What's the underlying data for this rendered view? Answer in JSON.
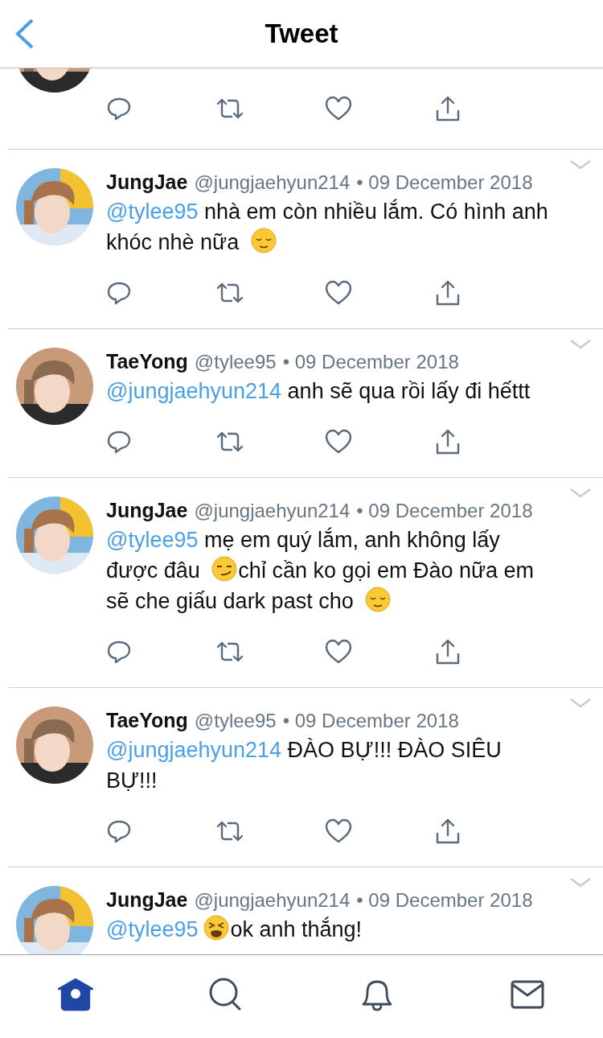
{
  "header": {
    "title": "Tweet"
  },
  "tweets": [
    {
      "partial": true,
      "avatar": {
        "kind": "picture"
      }
    },
    {
      "name": "JungJae",
      "handle": "@jungjaehyun214",
      "date": "• 09 December 2018",
      "avatar": {
        "kind": "picture"
      },
      "body": [
        {
          "kind": "mention",
          "text": "@tylee95"
        },
        {
          "kind": "text",
          "text": " nhà em còn nhiều lắm. Có hình anh khóc nhè nữa "
        },
        {
          "kind": "relieved"
        }
      ]
    },
    {
      "name": "TaeYong",
      "handle": "@tylee95",
      "date": "• 09 December 2018",
      "avatar": {
        "kind": "picture"
      },
      "body": [
        {
          "kind": "mention",
          "text": "@jungjaehyun214"
        },
        {
          "kind": "text",
          "text": " anh sẽ qua rồi lấy đi hếttt"
        }
      ]
    },
    {
      "name": "JungJae",
      "handle": "@jungjaehyun214",
      "date": "• 09 December 2018",
      "avatar": {
        "kind": "picture"
      },
      "body": [
        {
          "kind": "mention",
          "text": "@tylee95"
        },
        {
          "kind": "text",
          "text": " mẹ em quý lắm, anh không lấy được đâu "
        },
        {
          "kind": "smirk"
        },
        {
          "kind": "text",
          "text": "chỉ cần ko gọi em Đào nữa em sẽ che giấu dark past cho "
        },
        {
          "kind": "relieved"
        }
      ]
    },
    {
      "name": "TaeYong",
      "handle": "@tylee95",
      "date": "• 09 December 2018",
      "avatar": {
        "kind": "picture"
      },
      "body": [
        {
          "kind": "mention",
          "text": "@jungjaehyun214"
        },
        {
          "kind": "text",
          "text": " ĐÀO BỰ!!! ĐÀO SIÊU BỰ!!!"
        }
      ]
    },
    {
      "name": "JungJae",
      "handle": "@jungjaehyun214",
      "date": "• 09 December 2018",
      "avatar": {
        "kind": "picture"
      },
      "body": [
        {
          "kind": "mention",
          "text": "@tylee95"
        },
        {
          "kind": "tired"
        },
        {
          "kind": "text",
          "text": "ok anh thắng!"
        }
      ]
    }
  ],
  "tabs": [
    {
      "kind": "home",
      "selected": true
    },
    {
      "kind": "search",
      "selected": false
    },
    {
      "kind": "bell",
      "selected": false
    },
    {
      "kind": "mail",
      "selected": false
    }
  ]
}
